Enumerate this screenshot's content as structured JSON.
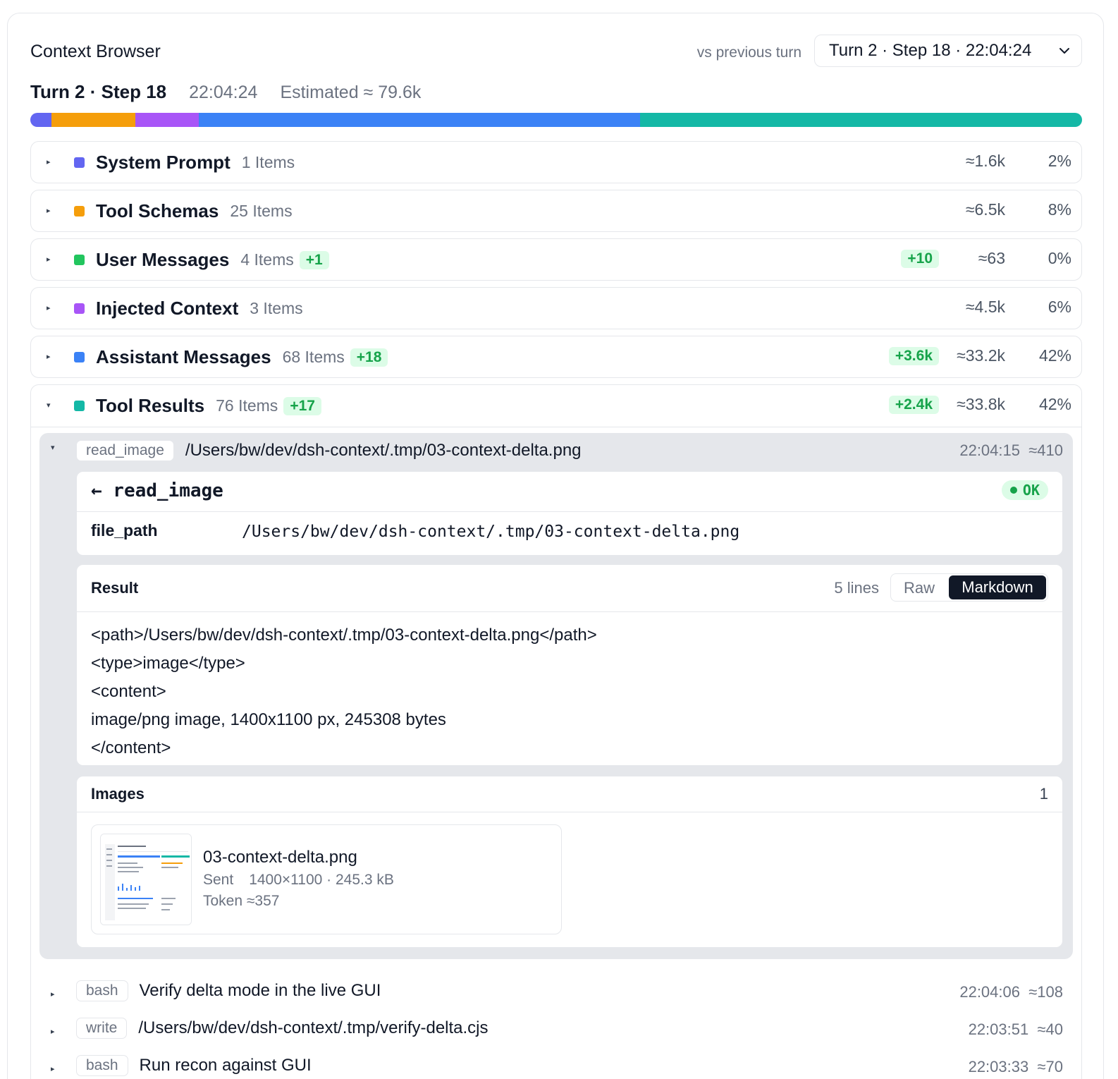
{
  "header": {
    "title": "Context Browser",
    "vs_label": "vs previous turn",
    "turn_select": "Turn 2 · Step 18 · 22:04:24"
  },
  "summary": {
    "turn": "Turn 2 · Step 18",
    "time": "22:04:24",
    "estimated": "Estimated ≈ 79.6k"
  },
  "bar_segments": [
    {
      "name": "System Prompt",
      "color": "#6366f1",
      "fraction": 0.02
    },
    {
      "name": "Tool Schemas",
      "color": "#f59e0b",
      "fraction": 0.08
    },
    {
      "name": "Injected Context",
      "color": "#a855f7",
      "fraction": 0.06
    },
    {
      "name": "Assistant Messages",
      "color": "#3b82f6",
      "fraction": 0.42
    },
    {
      "name": "Tool Results",
      "color": "#14b8a6",
      "fraction": 0.42
    }
  ],
  "categories": [
    {
      "name": "System Prompt",
      "count": "1 Items",
      "delta": "",
      "tok_delta": "",
      "tokens": "≈1.6k",
      "pct": "2%",
      "color": "#6366f1"
    },
    {
      "name": "Tool Schemas",
      "count": "25 Items",
      "delta": "",
      "tok_delta": "",
      "tokens": "≈6.5k",
      "pct": "8%",
      "color": "#f59e0b"
    },
    {
      "name": "User Messages",
      "count": "4 Items",
      "delta": "+1",
      "tok_delta": "+10",
      "tokens": "≈63",
      "pct": "0%",
      "color": "#22c55e"
    },
    {
      "name": "Injected Context",
      "count": "3 Items",
      "delta": "",
      "tok_delta": "",
      "tokens": "≈4.5k",
      "pct": "6%",
      "color": "#a855f7"
    },
    {
      "name": "Assistant Messages",
      "count": "68 Items",
      "delta": "+18",
      "tok_delta": "+3.6k",
      "tokens": "≈33.2k",
      "pct": "42%",
      "color": "#3b82f6"
    },
    {
      "name": "Tool Results",
      "count": "76 Items",
      "delta": "+17",
      "tok_delta": "+2.4k",
      "tokens": "≈33.8k",
      "pct": "42%",
      "color": "#14b8a6"
    }
  ],
  "open_item": {
    "tag": "read_image",
    "path": "/Users/bw/dev/dsh-context/.tmp/03-context-delta.png",
    "time": "22:04:15",
    "tokens": "≈410",
    "call_title": "← read_image",
    "status": "OK",
    "param_key": "file_path",
    "param_value": "/Users/bw/dev/dsh-context/.tmp/03-context-delta.png",
    "result_title": "Result",
    "result_lines": "5 lines",
    "raw_label": "Raw",
    "markdown_label": "Markdown",
    "result_body": [
      "<path>/Users/bw/dev/dsh-context/.tmp/03-context-delta.png</path>",
      "<type>image</type>",
      "<content>",
      "image/png image, 1400x1100 px, 245308 bytes",
      "</content>"
    ],
    "images_title": "Images",
    "images_count": "1",
    "image": {
      "filename": "03-context-delta.png",
      "sent_label": "Sent",
      "sent_value": "1400×1100 · 245.3 kB",
      "token_label": "Token ≈357"
    }
  },
  "other_items": [
    {
      "tag": "bash",
      "desc": "Verify delta mode in the live GUI",
      "time": "22:04:06",
      "tokens": "≈108"
    },
    {
      "tag": "write",
      "desc": "/Users/bw/dev/dsh-context/.tmp/verify-delta.cjs",
      "time": "22:03:51",
      "tokens": "≈40"
    },
    {
      "tag": "bash",
      "desc": "Run recon against GUI",
      "time": "22:03:33",
      "tokens": "≈70"
    }
  ]
}
